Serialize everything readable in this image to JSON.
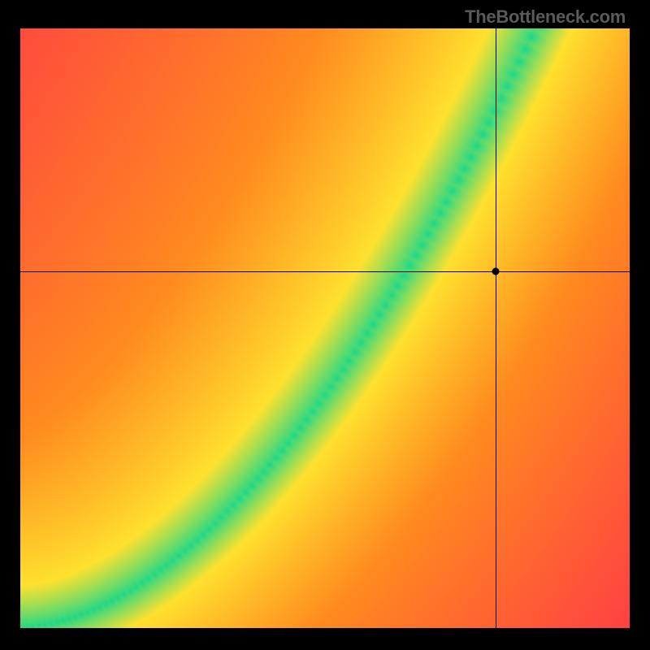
{
  "watermark": "TheBottleneck.com",
  "chart_data": {
    "type": "heatmap",
    "title": "",
    "xlabel": "",
    "ylabel": "",
    "xlim": [
      0,
      1
    ],
    "ylim": [
      0,
      1
    ],
    "colormap_description": "Red (low/mismatch) → Orange → Yellow → Green (optimal ridge) arranged radially around an optimal curve",
    "optimal_ridge": {
      "description": "approximately y ≈ x^1.8 mapped across [0,1] — thin green band marks balanced configuration",
      "points": [
        {
          "x": 0.0,
          "y": 0.0
        },
        {
          "x": 0.1,
          "y": 0.02
        },
        {
          "x": 0.2,
          "y": 0.06
        },
        {
          "x": 0.3,
          "y": 0.13
        },
        {
          "x": 0.4,
          "y": 0.23
        },
        {
          "x": 0.5,
          "y": 0.35
        },
        {
          "x": 0.6,
          "y": 0.5
        },
        {
          "x": 0.7,
          "y": 0.67
        },
        {
          "x": 0.8,
          "y": 0.86
        },
        {
          "x": 0.86,
          "y": 1.0
        }
      ]
    },
    "crosshair_marker": {
      "x": 0.78,
      "y": 0.595,
      "note": "black crosshair + dot marking a sampled (CPU, GPU) point in the orange/yellow region (right of green ridge)"
    },
    "legend": null,
    "annotations": []
  },
  "colors": {
    "black": "#000000",
    "red": "#ff2c4c",
    "orange": "#ff8a1f",
    "yellow": "#ffe12e",
    "green": "#17d88b"
  }
}
